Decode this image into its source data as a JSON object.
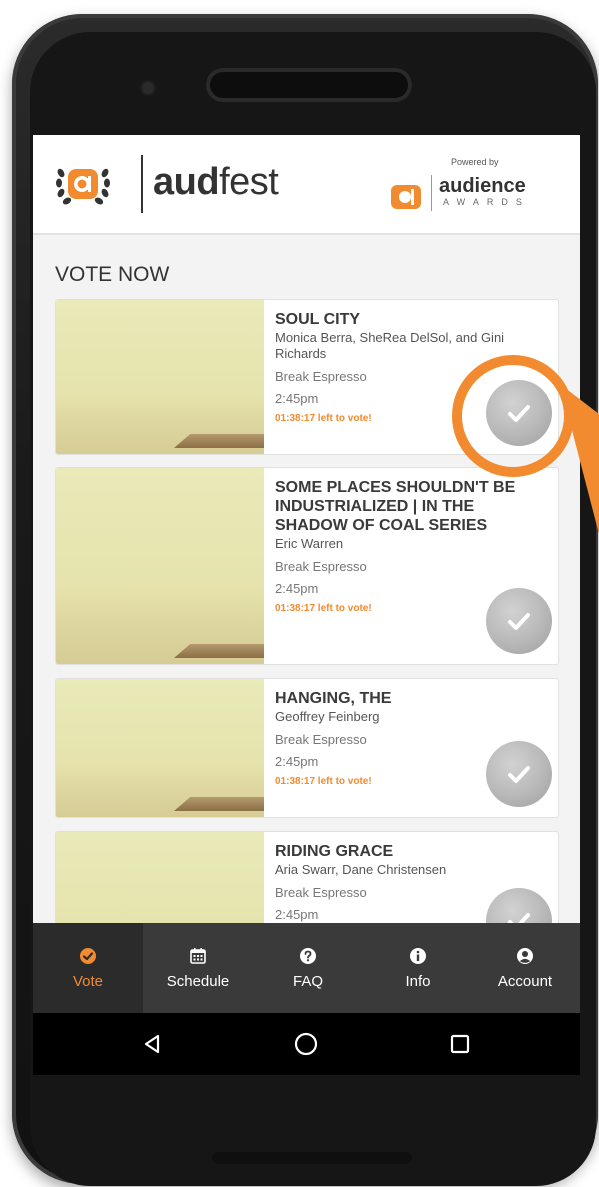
{
  "app": {
    "name_bold": "aud",
    "name_light": "fest",
    "powered_by": "Powered by",
    "partner_name": "audience",
    "partner_sub": "AWARDS"
  },
  "section_title": "VOTE NOW",
  "films": [
    {
      "title": "SOUL CITY",
      "credits": "Monica Berra, SheRea DelSol, and Gini Richards",
      "venue": "Break Espresso",
      "time": "2:45pm",
      "countdown": "01:38:17 left to vote!"
    },
    {
      "title": "SOME PLACES SHOULDN'T BE INDUSTRIALIZED | IN THE SHADOW OF COAL SERIES",
      "credits": "Eric Warren",
      "venue": "Break Espresso",
      "time": "2:45pm",
      "countdown": "01:38:17 left to vote!"
    },
    {
      "title": "HANGING, THE",
      "credits": "Geoffrey Feinberg",
      "venue": "Break Espresso",
      "time": "2:45pm",
      "countdown": "01:38:17 left to vote!"
    },
    {
      "title": "RIDING GRACE",
      "credits": "Aria Swarr, Dane Christensen",
      "venue": "Break Espresso",
      "time": "2:45pm",
      "countdown": ""
    }
  ],
  "tabs": [
    {
      "label": "Vote",
      "icon": "check-circle-icon",
      "active": true
    },
    {
      "label": "Schedule",
      "icon": "calendar-icon",
      "active": false
    },
    {
      "label": "FAQ",
      "icon": "question-icon",
      "active": false
    },
    {
      "label": "Info",
      "icon": "info-icon",
      "active": false
    },
    {
      "label": "Account",
      "icon": "user-icon",
      "active": false
    }
  ],
  "system_nav": [
    "back-icon",
    "home-icon",
    "recents-icon"
  ],
  "colors": {
    "accent": "#f28b30",
    "tabbar": "#3a3a3a",
    "vote_button": "#b8b8b8"
  }
}
